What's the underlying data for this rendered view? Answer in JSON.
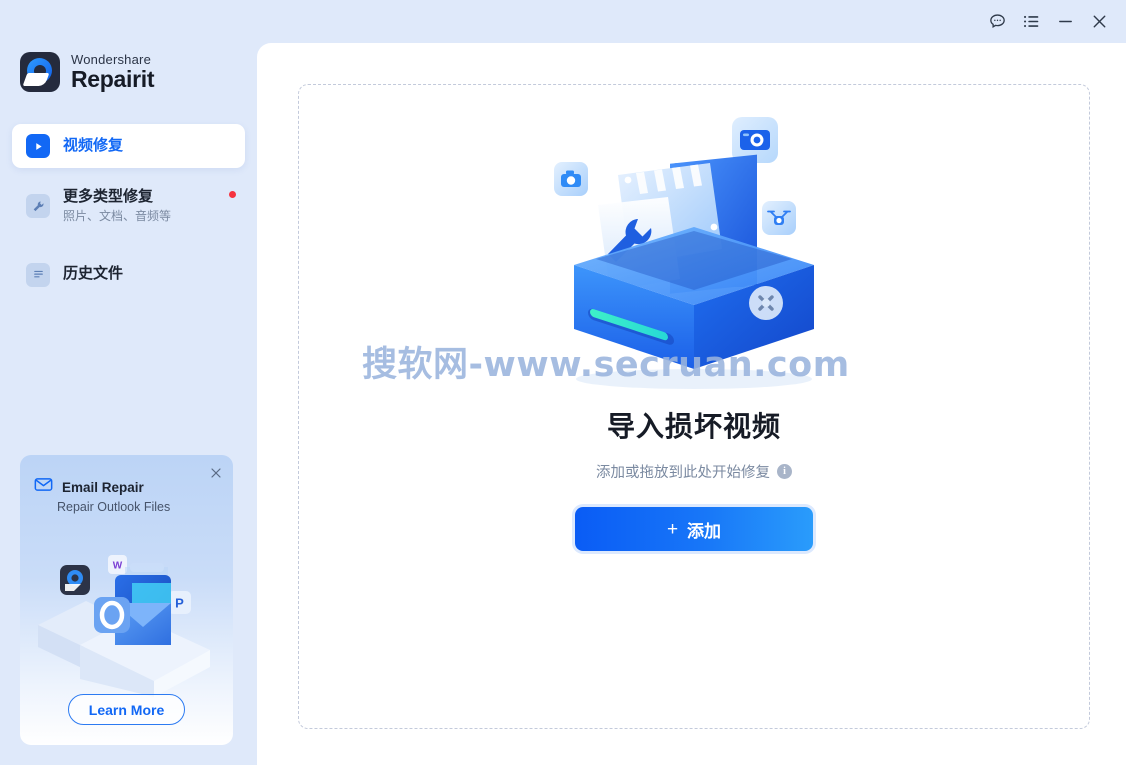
{
  "titlebar": {
    "buttons": [
      {
        "name": "feedback-icon",
        "label": "Feedback"
      },
      {
        "name": "menu-icon",
        "label": "Menu"
      },
      {
        "name": "minimize-icon",
        "label": "Minimize"
      },
      {
        "name": "close-icon",
        "label": "Close"
      }
    ]
  },
  "logo": {
    "brand_top": "Wondershare",
    "brand_bottom": "Repairit"
  },
  "sidebar": {
    "items": [
      {
        "label": "视频修复",
        "sub": "",
        "icon": "play-icon",
        "active": true,
        "badge": false
      },
      {
        "label": "更多类型修复",
        "sub": "照片、文档、音频等",
        "icon": "wrench-icon",
        "active": false,
        "badge": true
      },
      {
        "label": "历史文件",
        "sub": "",
        "icon": "history-file-icon",
        "active": false,
        "badge": false
      }
    ]
  },
  "promo": {
    "title": "Email Repair",
    "subtitle": "Repair Outlook Files",
    "button_label": "Learn More",
    "close_label": "×",
    "art_labels": {
      "word": "W",
      "outlook": "O",
      "powerpoint": "P"
    }
  },
  "main": {
    "headline": "导入损坏视频",
    "subtitle": "添加或拖放到此处开始修复",
    "info_glyph": "i",
    "add_button": {
      "plus": "+",
      "label": "添加"
    }
  },
  "watermark": {
    "text": "搜软网-www.secruan.com"
  },
  "colors": {
    "accent": "#1268f5",
    "sidebar_bg": "#dfe9fa",
    "panel_bg": "#ffffff",
    "badge_red": "#f5333f",
    "dash_border": "#c3cadb",
    "muted_text": "#7b8aa1"
  }
}
